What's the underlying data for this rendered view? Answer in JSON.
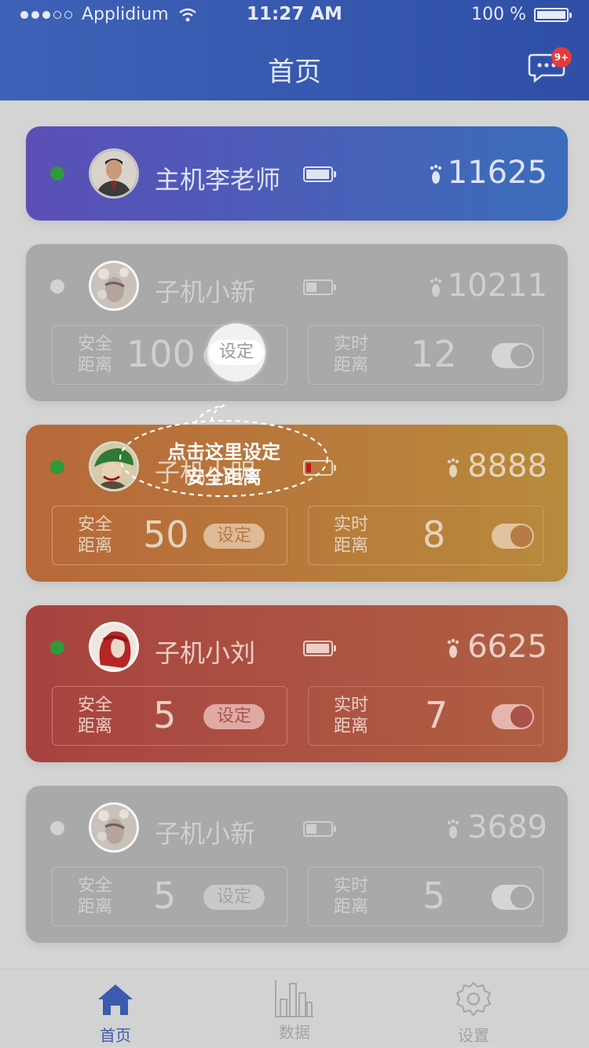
{
  "status": {
    "carrier": "Applidium",
    "time": "11:27 AM",
    "battery": "100 %"
  },
  "nav": {
    "title": "首页",
    "badge": "9+"
  },
  "master": {
    "name": "主机李老师",
    "steps": "11625",
    "online": true,
    "battery_level": 1.0
  },
  "children": [
    {
      "name": "子机小新",
      "steps": "10211",
      "online": false,
      "battery_level": 0.45,
      "safe_label": "安全\n距离",
      "safe_value": "100",
      "set_label": "设定",
      "rt_label": "实时\n距离",
      "rt_value": "12"
    },
    {
      "name": "子机小明",
      "steps": "8888",
      "online": true,
      "battery_level": 0.2,
      "safe_label": "安全\n距离",
      "safe_value": "50",
      "set_label": "设定",
      "rt_label": "实时\n距离",
      "rt_value": "8"
    },
    {
      "name": "子机小刘",
      "steps": "6625",
      "online": true,
      "battery_level": 1.0,
      "safe_label": "安全\n距离",
      "safe_value": "5",
      "set_label": "设定",
      "rt_label": "实时\n距离",
      "rt_value": "7"
    },
    {
      "name": "子机小新",
      "steps": "3689",
      "online": false,
      "battery_level": 0.45,
      "safe_label": "安全\n距离",
      "safe_value": "5",
      "set_label": "设定",
      "rt_label": "实时\n距离",
      "rt_value": "5"
    }
  ],
  "tutorial": {
    "line1": "点击这里设定",
    "line2": "安全距离"
  },
  "tabs": [
    {
      "label": "首页",
      "active": true
    },
    {
      "label": "数据",
      "active": false
    },
    {
      "label": "设置",
      "active": false
    }
  ],
  "colors": {
    "header": "#3a5bb0",
    "active_tab": "#3a5bb0",
    "online": "#2f9a3c",
    "low_battery": "#c0191f"
  }
}
